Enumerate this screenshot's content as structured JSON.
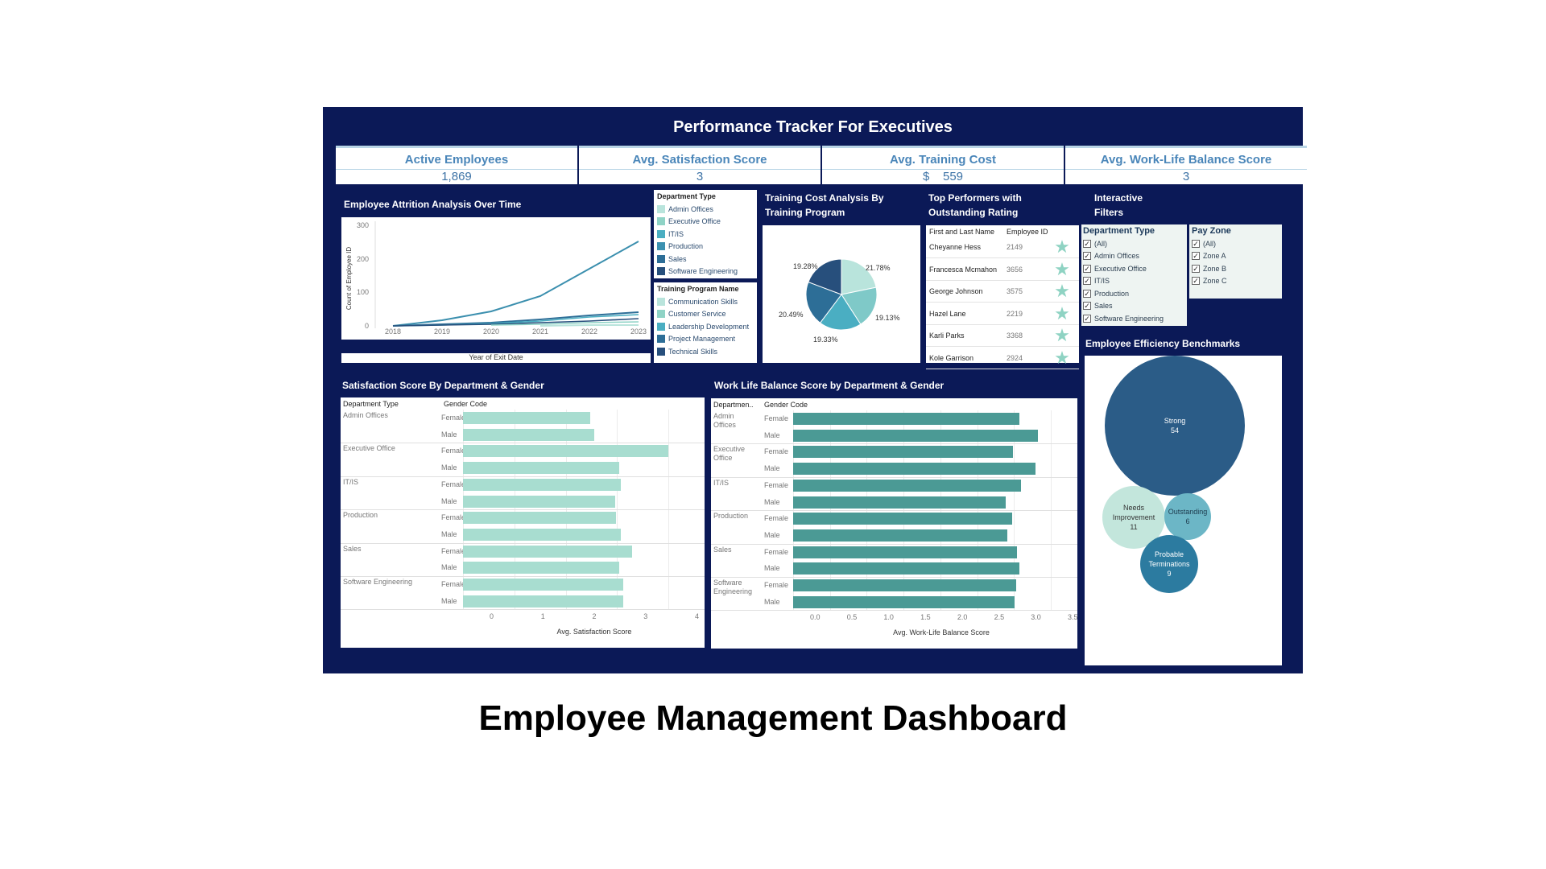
{
  "dashboard": {
    "title": "Performance Tracker For Executives",
    "kpis": [
      {
        "label": "Active Employees",
        "value": "1,869"
      },
      {
        "label": "Avg. Satisfaction Score",
        "value": "3"
      },
      {
        "label": "Avg. Training Cost",
        "value": "$    559"
      },
      {
        "label": "Avg. Work-Life Balance Score",
        "value": "3"
      }
    ]
  },
  "attrition": {
    "title": "Employee Attrition Analysis Over Time",
    "ylabel": "Count of Employee ID",
    "xlabel": "Year of Exit Date",
    "yticks": [
      "300",
      "200",
      "100",
      "0"
    ],
    "xticks": [
      "2018",
      "2019",
      "2020",
      "2021",
      "2022",
      "2023"
    ]
  },
  "dept_legend": {
    "title": "Department Type",
    "items": [
      {
        "label": "Admin Offices",
        "color": "#b9e4dc"
      },
      {
        "label": "Executive Office",
        "color": "#8fd3c6"
      },
      {
        "label": "IT/IS",
        "color": "#4aaec2"
      },
      {
        "label": "Production",
        "color": "#3b91b1"
      },
      {
        "label": "Sales",
        "color": "#2d6e97"
      },
      {
        "label": "Software Engineering",
        "color": "#274f7c"
      }
    ]
  },
  "training_legend": {
    "title": "Training Program Name",
    "items": [
      {
        "label": "Communication Skills",
        "color": "#b9e4dc"
      },
      {
        "label": "Customer Service",
        "color": "#8fd3c6"
      },
      {
        "label": "Leadership Development",
        "color": "#4aaec2"
      },
      {
        "label": "Project Management",
        "color": "#2d6e97"
      },
      {
        "label": "Technical Skills",
        "color": "#274f7c"
      }
    ]
  },
  "training_cost": {
    "title": "Training Cost Analysis By Training Program",
    "labels": [
      "21.78%",
      "19.13%",
      "19.33%",
      "20.49%",
      "19.28%"
    ]
  },
  "top_performers": {
    "title": "Top Performers with Outstanding Rating",
    "col_name": "First and Last Name",
    "col_id": "Employee ID",
    "rows": [
      {
        "name": "Cheyanne Hess",
        "id": "2149"
      },
      {
        "name": "Francesca Mcmahon",
        "id": "3656"
      },
      {
        "name": "George Johnson",
        "id": "3575"
      },
      {
        "name": "Hazel Lane",
        "id": "2219"
      },
      {
        "name": "Karli Parks",
        "id": "3368"
      },
      {
        "name": "Kole Garrison",
        "id": "2924"
      }
    ],
    "star": "★"
  },
  "filters": {
    "title": "Interactive Filters",
    "dept": {
      "title": "Department Type",
      "options": [
        "(All)",
        "Admin Offices",
        "Executive Office",
        "IT/IS",
        "Production",
        "Sales",
        "Software Engineering"
      ]
    },
    "payzone": {
      "title": "Pay Zone",
      "options": [
        "(All)",
        "Zone A",
        "Zone B",
        "Zone C"
      ]
    },
    "check": "✓"
  },
  "satisfaction": {
    "title": "Satisfaction Score By Department & Gender",
    "col_dept": "Department Type",
    "col_gender": "Gender Code",
    "xlabel": "Avg. Satisfaction Score",
    "xticks": [
      "0",
      "1",
      "2",
      "3",
      "4"
    ],
    "max": 4,
    "color": "#a8ddd0",
    "depts": [
      "Admin Offices",
      "Executive Office",
      "IT/IS",
      "Production",
      "Sales",
      "Software Engineering"
    ],
    "genders": [
      "Female",
      "Male"
    ],
    "values": [
      2.48,
      2.56,
      4.0,
      3.05,
      3.08,
      2.96,
      2.98,
      3.08,
      3.3,
      3.04,
      3.12,
      3.12
    ]
  },
  "worklife": {
    "title": "Work Life Balance Score by Department & Gender",
    "col_dept": "Departmen..",
    "col_gender": "Gender Code",
    "xlabel": "Avg. Work-Life Balance Score",
    "xticks": [
      "0.0",
      "0.5",
      "1.0",
      "1.5",
      "2.0",
      "2.5",
      "3.0",
      "3.5"
    ],
    "max": 3.5,
    "color": "#4b9a95",
    "depts": [
      "Admin Offices",
      "Executive Office",
      "IT/IS",
      "Production",
      "Sales",
      "Software Engineering"
    ],
    "genders": [
      "Female",
      "Male"
    ],
    "values": [
      3.07,
      3.33,
      2.99,
      3.29,
      3.1,
      2.89,
      2.98,
      2.91,
      3.04,
      3.07,
      3.03,
      3.01
    ]
  },
  "efficiency": {
    "title": "Employee Efficiency Benchmarks",
    "bubbles": [
      {
        "label": "Strong",
        "value": "54",
        "color": "#2b5c87",
        "text": "#ffffff"
      },
      {
        "label": "Needs Improvement",
        "value": "11",
        "color": "#c3e6dc",
        "text": "#333333"
      },
      {
        "label": "Outstanding",
        "value": "6",
        "color": "#6cb6c6",
        "text": "#1d3a4d"
      },
      {
        "label": "Probable Terminations",
        "value": "9",
        "color": "#2c7ba0",
        "text": "#ffffff"
      }
    ]
  },
  "caption": "Employee Management Dashboard"
}
